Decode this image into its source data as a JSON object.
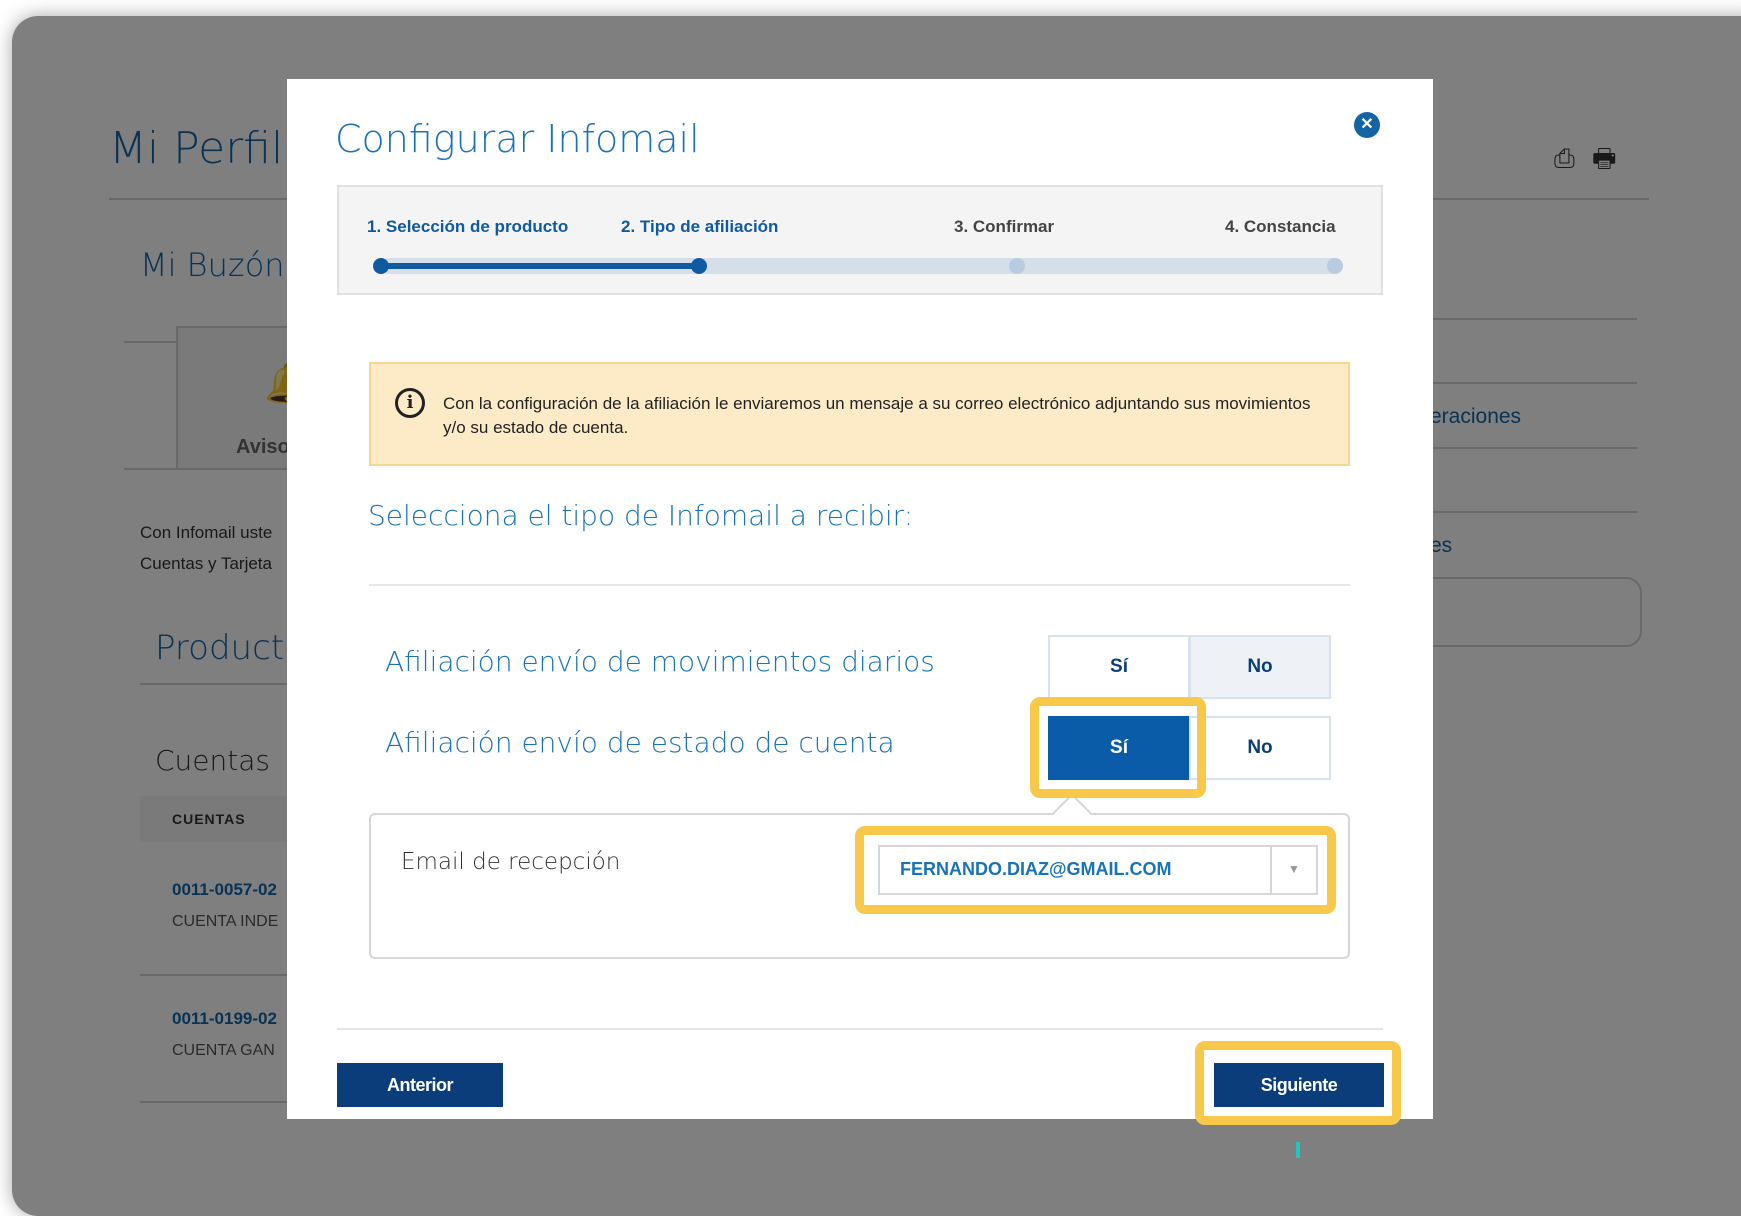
{
  "background": {
    "page_title": "Mi Perfil",
    "section_title": "Mi Buzón",
    "tab_label": "Aviso",
    "intro_line1": "Con Infomail uste",
    "intro_line2": "Cuentas y Tarjeta",
    "products_title": "Producto",
    "accounts_title": "Cuentas",
    "table_header": "CUENTAS",
    "accounts": [
      {
        "number": "0011-0057-02",
        "type": "CUENTA INDE"
      },
      {
        "number": "0011-0199-02",
        "type": "CUENTA GAN"
      }
    ],
    "right_items": [
      "eraciones",
      "es"
    ],
    "icons": [
      "pdf-icon",
      "print-icon"
    ]
  },
  "modal": {
    "title": "Configurar Infomail",
    "close_icon": "close-icon",
    "steps": [
      {
        "label": "1. Selección de producto",
        "state": "done"
      },
      {
        "label": "2. Tipo de afiliación",
        "state": "current"
      },
      {
        "label": "3. Confirmar",
        "state": "pending"
      },
      {
        "label": "4. Constancia",
        "state": "pending"
      }
    ],
    "alert_text": "Con la configuración de la afiliación le enviaremos un mensaje a su correo electrónico adjuntando sus movimientos y/o su estado de cuenta.",
    "select_title": "Selecciona el tipo de Infomail a recibir:",
    "options": [
      {
        "label": "Afiliación envío de movimientos diarios",
        "yes": "Sí",
        "no": "No",
        "selected": "No"
      },
      {
        "label": "Afiliación envío de estado de cuenta",
        "yes": "Sí",
        "no": "No",
        "selected": "Sí"
      }
    ],
    "email": {
      "label": "Email de recepción",
      "value": "FERNANDO.DIAZ@GMAIL.COM"
    },
    "buttons": {
      "prev": "Anterior",
      "next": "Siguiente"
    }
  },
  "colors": {
    "brand_blue": "#1973b8",
    "dark_blue": "#0b3d7a",
    "highlight": "#f7c84a",
    "alert_bg": "#fdebc8"
  }
}
